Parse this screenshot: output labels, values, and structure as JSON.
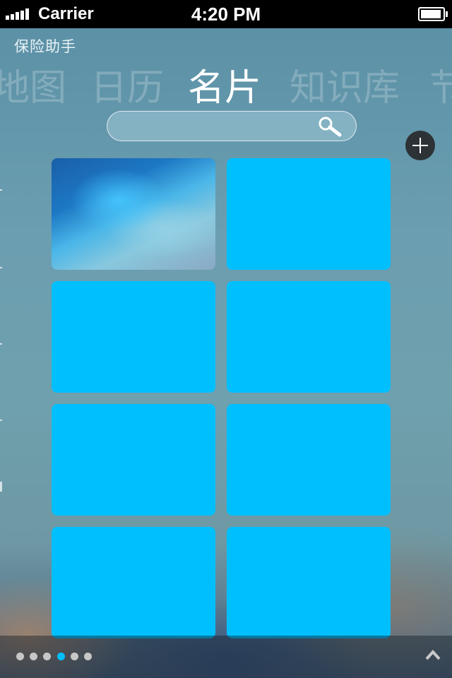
{
  "status_bar": {
    "carrier": "Carrier",
    "time": "4:20 PM"
  },
  "app": {
    "title": "保险助手"
  },
  "tabs": [
    {
      "label": "地图",
      "active": false
    },
    {
      "label": "日历",
      "active": false
    },
    {
      "label": "名片",
      "active": true
    },
    {
      "label": "知识库",
      "active": false
    },
    {
      "label": "节",
      "active": false
    }
  ],
  "search": {
    "placeholder": "",
    "icon": "search-icon"
  },
  "add_button": {
    "icon": "plus-icon"
  },
  "cards": [
    {
      "type": "photo"
    },
    {
      "type": "blank"
    },
    {
      "type": "blank"
    },
    {
      "type": "blank"
    },
    {
      "type": "blank"
    },
    {
      "type": "blank"
    },
    {
      "type": "blank"
    },
    {
      "type": "blank"
    }
  ],
  "pager": {
    "total": 6,
    "current_index": 3
  },
  "colors": {
    "accent": "#00bfff",
    "status_bar": "#000000",
    "add_button": "#2c3236"
  }
}
